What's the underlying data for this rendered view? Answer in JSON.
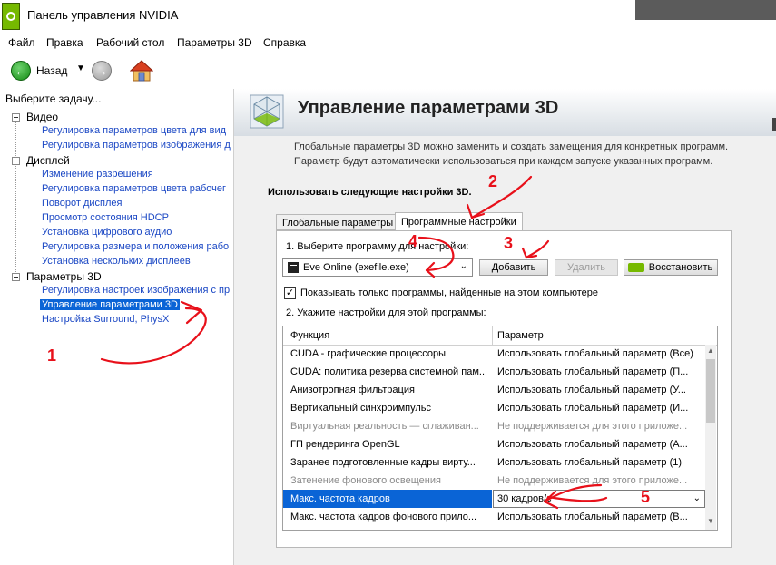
{
  "window": {
    "title": "Панель управления NVIDIA"
  },
  "menu": [
    "Файл",
    "Правка",
    "Рабочий стол",
    "Параметры 3D",
    "Справка"
  ],
  "toolbar": {
    "back_label": "Назад",
    "back_dropdown": "▼"
  },
  "sidebar": {
    "header": "Выберите задачу...",
    "categories": [
      {
        "label": "Видео",
        "items": [
          "Регулировка параметров цвета для вид",
          "Регулировка параметров изображения д"
        ]
      },
      {
        "label": "Дисплей",
        "items": [
          "Изменение разрешения",
          "Регулировка параметров цвета рабочег",
          "Поворот дисплея",
          "Просмотр состояния HDCP",
          "Установка цифрового аудио",
          "Регулировка размера и положения рабо",
          "Установка нескольких дисплеев"
        ]
      },
      {
        "label": "Параметры 3D",
        "items": [
          "Регулировка настроек изображения с пр",
          "Управление параметрами 3D",
          "Настройка Surround, PhysX"
        ]
      }
    ]
  },
  "main": {
    "title": "Управление параметрами 3D",
    "description": "Глобальные параметры 3D можно заменить и создать замещения для конкретных программ. Параметр будут автоматически использоваться при каждом запуске указанных программ.",
    "settings_title": "Использовать следующие настройки 3D.",
    "tabs": [
      "Глобальные параметры",
      "Программные настройки"
    ],
    "step1": "1. Выберите программу для настройки:",
    "program_selected": "Eve Online (exefile.exe)",
    "buttons": {
      "add": "Добавить",
      "remove": "Удалить",
      "restore": "Восстановить"
    },
    "checkbox_label": "Показывать только программы, найденные на этом компьютере",
    "checkbox_mark": "✓",
    "step2": "2. Укажите настройки для этой программы:",
    "grid": {
      "headers": [
        "Функция",
        "Параметр"
      ],
      "rows": [
        [
          "CUDA - графические процессоры",
          "Использовать глобальный параметр (Все)"
        ],
        [
          "CUDA: политика резерва системной пам...",
          "Использовать глобальный параметр (П..."
        ],
        [
          "Анизотропная фильтрация",
          "Использовать глобальный параметр (У..."
        ],
        [
          "Вертикальный синхроимпульс",
          "Использовать глобальный параметр (И..."
        ],
        [
          "Виртуальная реальность — сглаживан...",
          "Не поддерживается для этого приложе..."
        ],
        [
          "ГП рендеринга OpenGL",
          "Использовать глобальный параметр (А..."
        ],
        [
          "Заранее подготовленные кадры вирту...",
          "Использовать глобальный параметр (1)"
        ],
        [
          "Затенение фонового освещения",
          "Не поддерживается для этого приложе..."
        ],
        [
          "Макс. частота кадров",
          "30 кадров/с"
        ],
        [
          "Макс. частота кадров фонового прило...",
          "Использовать глобальный параметр (В..."
        ]
      ]
    }
  },
  "annotations": [
    "1",
    "2",
    "3",
    "4",
    "5"
  ],
  "colors": {
    "accent": "#0a64d6",
    "nvidia_green": "#76b900",
    "annotation": "#e8101a"
  }
}
